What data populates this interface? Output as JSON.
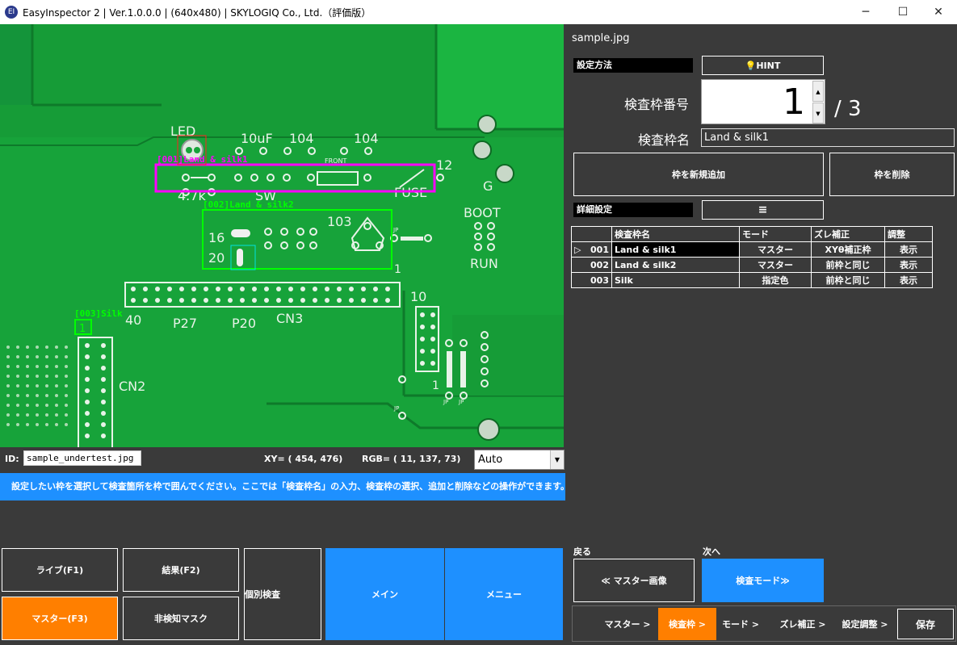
{
  "window": {
    "icon_text": "EI",
    "title": "EasyInspector 2 | Ver.1.0.0.0 | (640x480) | SKYLOGIQ Co., Ltd.（評価版）",
    "minimize": "─",
    "maximize": "☐",
    "close": "✕"
  },
  "board": {
    "labels": {
      "led": "LED",
      "c10uf": "10uF",
      "c104a": "104",
      "c104b": "104",
      "front": "FRONT",
      "n12": "12",
      "g": "G",
      "r47k": "4.7k",
      "sw": "SW",
      "fuse": "FUSE",
      "boot": "BOOT",
      "run": "RUN",
      "n16": "16",
      "n20": "20",
      "n103": "103",
      "jp1": "JP",
      "n1a": "1",
      "n40": "40",
      "p27": "P27",
      "p20": "P20",
      "cn3": "CN3",
      "n10": "10",
      "cn2": "CN2",
      "n1b": "1",
      "jp2": "JP",
      "jp3": "JP",
      "jp4": "JP"
    },
    "frames": [
      {
        "label": "[001]Land & silk1",
        "color": "#ff00ff"
      },
      {
        "label": "[002]Land & silk2",
        "color": "#00ff00"
      },
      {
        "label": "[003]Silk",
        "color": "#00ff00"
      }
    ],
    "frame_box_label": "1"
  },
  "status": {
    "id_label": "ID:",
    "id_value": "sample_undertest.jpg",
    "xy": "XY= ( 454,  476)",
    "rgb": "RGB= ( 11, 137,  73)",
    "mode_select": "Auto"
  },
  "info": "設定したい枠を選択して検査箇所を枠で囲んでください。ここでは「検査枠名」の入力、検査枠の選択、追加と削除などの操作ができます。",
  "bottom_left": {
    "live": "ライブ(F1)",
    "result": "結果(F2)",
    "individual": "個別検査",
    "main": "メイン",
    "menu": "メニュー",
    "master": "マスター(F3)",
    "nondetect": "非検知マスク"
  },
  "right": {
    "file_name": "sample.jpg",
    "setting_method": "設定方法",
    "hint": "💡HINT",
    "frame_number_label": "検査枠番号",
    "frame_number": "1",
    "frame_total": "/ 3",
    "frame_name_label": "検査枠名",
    "frame_name_value": "Land & silk1",
    "add_frame": "枠を新規追加",
    "delete_frame": "枠を削除",
    "detail_setting": "詳細設定",
    "detail_menu": "≡",
    "table": {
      "headers": [
        "",
        "検査枠名",
        "モード",
        "ズレ補正",
        "調整"
      ],
      "rows": [
        {
          "marker": "▷",
          "no": "001",
          "name": "Land & silk1",
          "mode": "マスター",
          "shift": "XYθ補正枠",
          "adjust": "表示"
        },
        {
          "marker": "",
          "no": "002",
          "name": "Land & silk2",
          "mode": "マスター",
          "shift": "前枠と同じ",
          "adjust": "表示"
        },
        {
          "marker": "",
          "no": "003",
          "name": "Silk",
          "mode": "指定色",
          "shift": "前枠と同じ",
          "adjust": "表示"
        }
      ]
    },
    "back_label": "戻る",
    "next_label": "次へ",
    "back_button": "≪ マスター画像",
    "next_button": "検査モード≫",
    "steps": [
      "マスター >",
      "検査枠 >",
      "モード >",
      "ズレ補正 >",
      "設定調整 >"
    ],
    "save": "保存"
  },
  "colors": {
    "accent_blue": "#1e90ff",
    "accent_orange": "#ff7f00",
    "panel_bg": "#3a3a3a",
    "board_green": "#17a33a"
  }
}
